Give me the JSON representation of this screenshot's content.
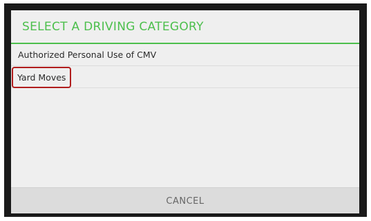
{
  "dialog": {
    "title": "SELECT A DRIVING CATEGORY",
    "accent_color": "#4cbf4c",
    "options": [
      {
        "label": "Authorized Personal Use of CMV",
        "highlighted": false
      },
      {
        "label": "Yard Moves",
        "highlighted": true
      }
    ],
    "cancel_label": "CANCEL",
    "highlight_color": "#b01c1c"
  }
}
